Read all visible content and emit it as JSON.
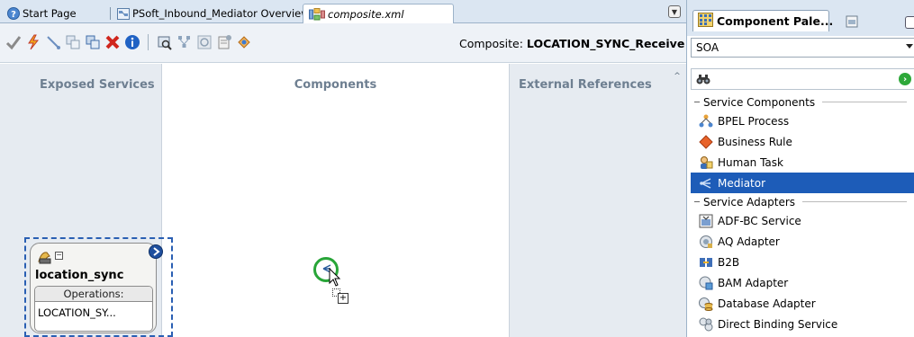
{
  "editor_tabs": [
    {
      "label": "Start Page",
      "icon": "help-icon"
    },
    {
      "label": "PSoft_Inbound_Mediator Overview",
      "icon": "overview-icon"
    },
    {
      "label": "composite.xml",
      "icon": "composite-icon",
      "active": true
    }
  ],
  "toolbar": {
    "composite_prefix": "Composite:",
    "composite_name": "LOCATION_SYNC_Receive",
    "icons": [
      "validate-icon",
      "deploy-icon",
      "wire-icon",
      "copy-icon",
      "paste-icon",
      "delete-icon",
      "info-icon",
      "find-icon",
      "layout-icon",
      "refresh-icon",
      "properties-icon",
      "test-icon"
    ]
  },
  "lanes": {
    "exposed": "Exposed Services",
    "components": "Components",
    "external": "External References"
  },
  "service": {
    "name": "location_sync",
    "operations_label": "Operations:",
    "operation": "LOCATION_SY..."
  },
  "palette": {
    "title": "Component Pale...",
    "category": "SOA",
    "search_placeholder": "",
    "sections": [
      {
        "title": "Service Components",
        "items": [
          {
            "label": "BPEL Process",
            "icon": "bpel-icon"
          },
          {
            "label": "Business Rule",
            "icon": "business-rule-icon"
          },
          {
            "label": "Human Task",
            "icon": "human-task-icon"
          },
          {
            "label": "Mediator",
            "icon": "mediator-icon",
            "selected": true
          }
        ]
      },
      {
        "title": "Service Adapters",
        "items": [
          {
            "label": "ADF-BC Service",
            "icon": "adf-bc-icon"
          },
          {
            "label": "AQ Adapter",
            "icon": "aq-adapter-icon"
          },
          {
            "label": "B2B",
            "icon": "b2b-icon"
          },
          {
            "label": "BAM Adapter",
            "icon": "bam-adapter-icon"
          },
          {
            "label": "Database Adapter",
            "icon": "database-adapter-icon"
          },
          {
            "label": "Direct Binding Service",
            "icon": "direct-binding-icon"
          }
        ]
      }
    ]
  },
  "colors": {
    "selection": "#1d5cb8",
    "lane_bg": "#e6ebf1",
    "lane_title": "#6e7f91",
    "drop_target": "#28a538"
  }
}
